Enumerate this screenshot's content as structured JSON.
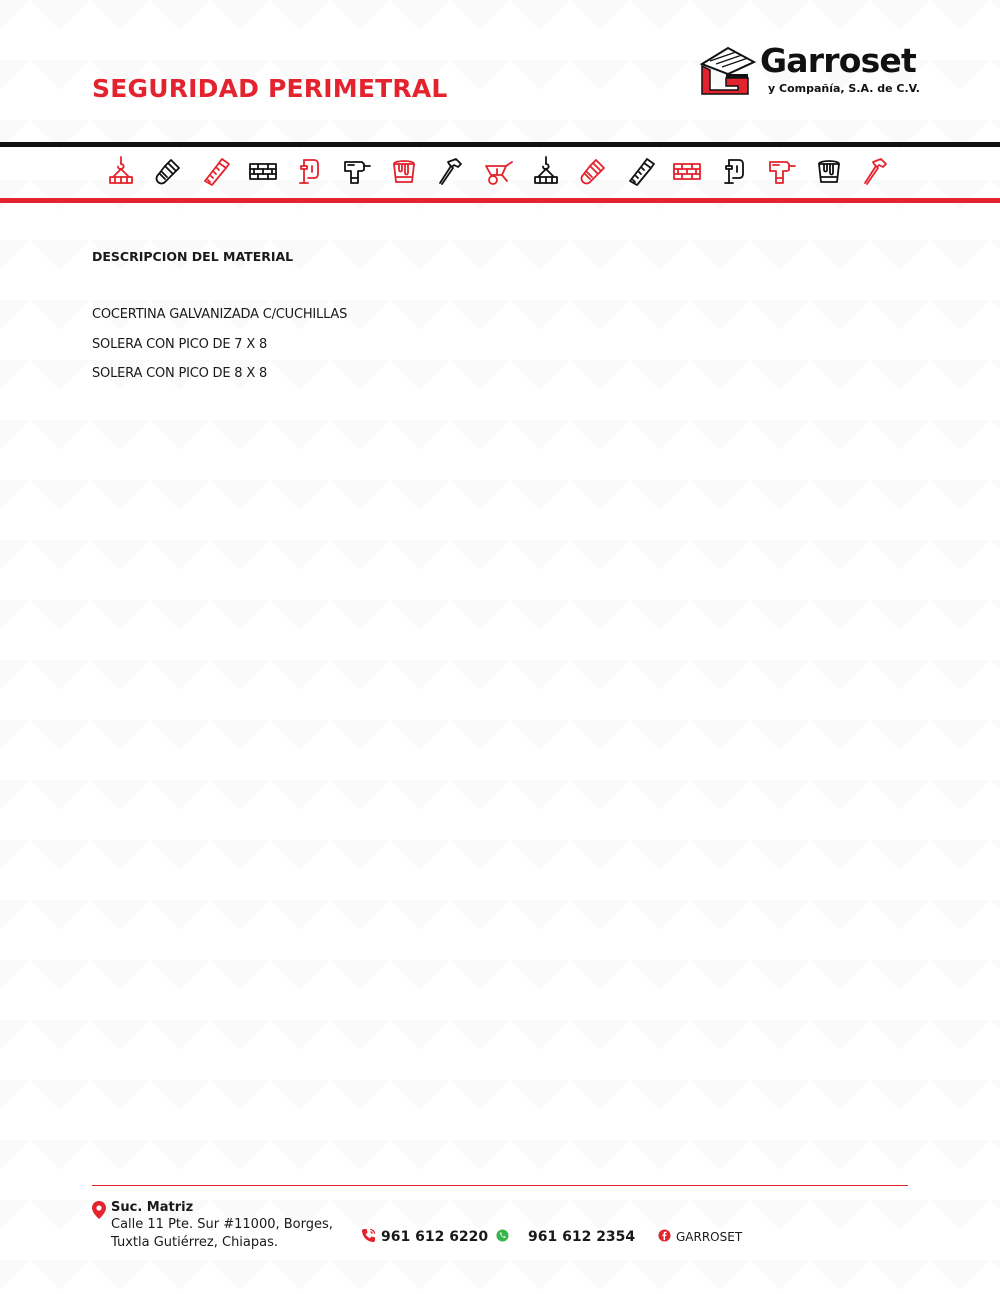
{
  "colors": {
    "accent": "#e3232d",
    "ink": "#111111",
    "whatsapp": "#3ab54a"
  },
  "header": {
    "title": "SEGURIDAD PERIMETRAL",
    "logo": {
      "name": "Garroset",
      "subtitle": "y Compañía, S.A. de C.V."
    }
  },
  "tools": [
    {
      "icon": "crane-hook-icon",
      "color": "red"
    },
    {
      "icon": "paint-brush-icon",
      "color": "black"
    },
    {
      "icon": "hand-saw-icon",
      "color": "red"
    },
    {
      "icon": "bricks-icon",
      "color": "black"
    },
    {
      "icon": "c-clamp-icon",
      "color": "red"
    },
    {
      "icon": "power-drill-icon",
      "color": "black"
    },
    {
      "icon": "paint-bucket-icon",
      "color": "red"
    },
    {
      "icon": "hammer-icon",
      "color": "black"
    },
    {
      "icon": "wheelbarrow-icon",
      "color": "red"
    },
    {
      "icon": "crane-hook-icon",
      "color": "black"
    },
    {
      "icon": "paint-brush-icon",
      "color": "red"
    },
    {
      "icon": "hand-saw-icon",
      "color": "black"
    },
    {
      "icon": "bricks-icon",
      "color": "red"
    },
    {
      "icon": "c-clamp-icon",
      "color": "black"
    },
    {
      "icon": "power-drill-icon",
      "color": "red"
    },
    {
      "icon": "paint-bucket-icon",
      "color": "black"
    },
    {
      "icon": "hammer-icon",
      "color": "red"
    }
  ],
  "content": {
    "section_heading": "DESCRIPCION DEL MATERIAL",
    "materials": [
      "COCERTINA GALVANIZADA C/CUCHILLAS",
      "SOLERA CON PICO DE 7 X 8",
      "SOLERA CON PICO DE 8 X 8"
    ]
  },
  "footer": {
    "branch_name": "Suc. Matriz",
    "address_line1": "Calle 11 Pte. Sur #11000, Borges,",
    "address_line2": "Tuxtla Gutiérrez, Chiapas.",
    "phone": "961 612 6220",
    "whatsapp": "961 612 2354",
    "facebook": "GARROSET"
  }
}
